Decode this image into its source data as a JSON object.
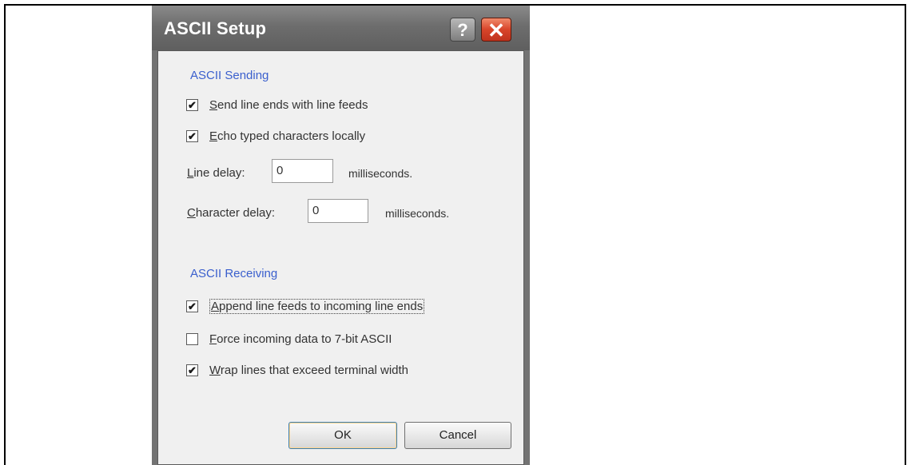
{
  "dialog": {
    "title": "ASCII Setup",
    "help_label": "?",
    "close_label": "✕"
  },
  "sending": {
    "group_title": "ASCII Sending",
    "send_line_ends": {
      "label": "Send line ends with line feeds",
      "accel": "S",
      "rest": "end line ends with line feeds",
      "checked": true
    },
    "echo_typed": {
      "label": "Echo typed characters locally",
      "accel": "E",
      "rest": "cho typed characters locally",
      "checked": true
    },
    "line_delay": {
      "label": "Line delay:",
      "accel": "L",
      "rest": "ine delay:",
      "value": "0",
      "unit": "milliseconds."
    },
    "char_delay": {
      "label": "Character delay:",
      "accel": "C",
      "rest": "haracter delay:",
      "value": "0",
      "unit": "milliseconds."
    }
  },
  "receiving": {
    "group_title": "ASCII Receiving",
    "append_line_feeds": {
      "label": "Append line feeds to incoming line ends",
      "accel": "A",
      "rest": "ppend line feeds to incoming line ends",
      "checked": true
    },
    "force_7bit": {
      "label": "Force incoming data to 7-bit ASCII",
      "accel": "F",
      "rest": "orce incoming data to 7-bit ASCII",
      "checked": false
    },
    "wrap_lines": {
      "label": "Wrap lines that exceed terminal width",
      "accel": "W",
      "rest": "rap lines that exceed terminal width",
      "checked": true
    }
  },
  "buttons": {
    "ok": "OK",
    "cancel": "Cancel"
  },
  "check_glyph": "✔"
}
